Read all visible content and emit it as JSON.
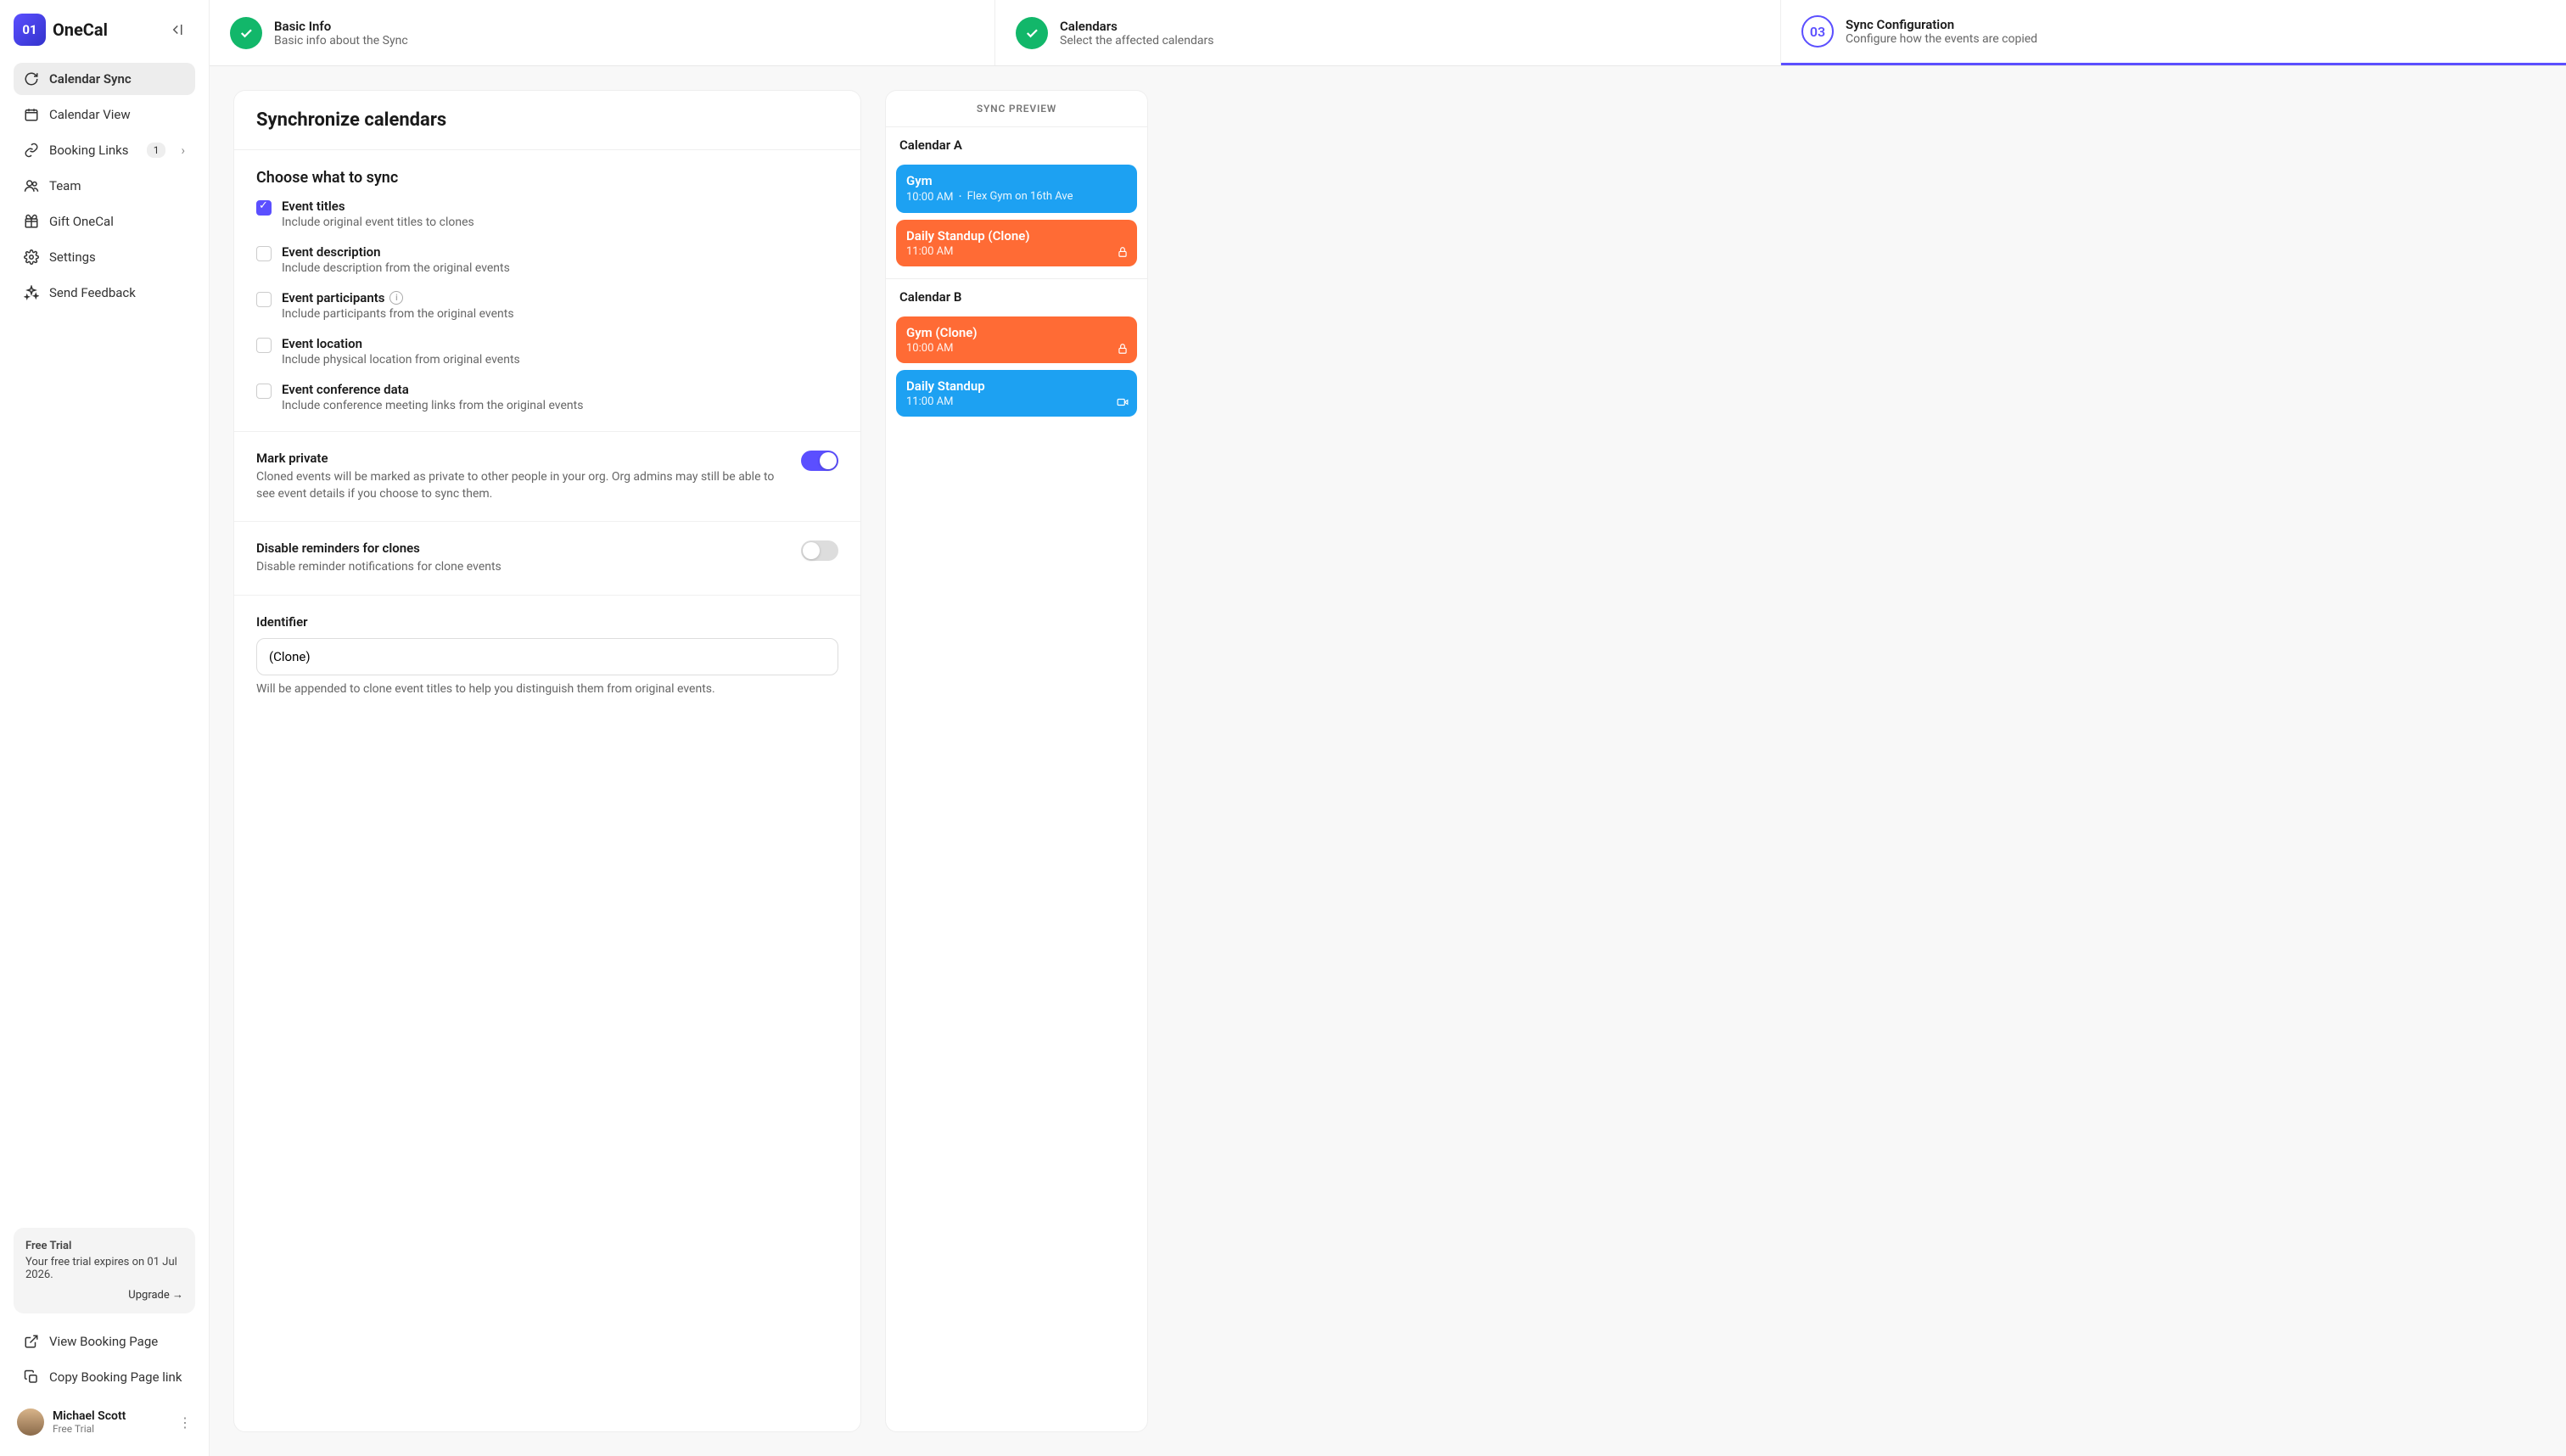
{
  "brand": {
    "logo_text": "OneCal",
    "logo_badge": "01"
  },
  "sidebar": {
    "items": [
      {
        "label": "Calendar Sync",
        "icon": "sync"
      },
      {
        "label": "Calendar View",
        "icon": "calendar"
      },
      {
        "label": "Booking Links",
        "icon": "link",
        "badge": "1",
        "expandable": true
      },
      {
        "label": "Team",
        "icon": "people"
      },
      {
        "label": "Gift OneCal",
        "icon": "gift"
      },
      {
        "label": "Settings",
        "icon": "gear"
      },
      {
        "label": "Send Feedback",
        "icon": "sparkle"
      }
    ],
    "trial": {
      "title": "Free Trial",
      "body": "Your free trial expires on 01 Jul 2026.",
      "upgrade": "Upgrade →"
    },
    "bottom": [
      {
        "label": "View Booking Page",
        "icon": "external"
      },
      {
        "label": "Copy Booking Page link",
        "icon": "copy"
      }
    ],
    "user": {
      "name": "Michael Scott",
      "plan": "Free Trial"
    }
  },
  "stepper": [
    {
      "title": "Basic Info",
      "sub": "Basic info about the Sync",
      "state": "done"
    },
    {
      "title": "Calendars",
      "sub": "Select the affected calendars",
      "state": "done"
    },
    {
      "title": "Sync Configuration",
      "sub": "Configure how the events are copied",
      "state": "active",
      "num": "03"
    }
  ],
  "sync": {
    "heading": "Synchronize calendars",
    "choose_heading": "Choose what to sync",
    "options": [
      {
        "label": "Event titles",
        "desc": "Include original event titles to clones",
        "checked": true
      },
      {
        "label": "Event description",
        "desc": "Include description from the original events",
        "checked": false
      },
      {
        "label": "Event participants",
        "desc": "Include participants from the original events",
        "checked": false,
        "info": true
      },
      {
        "label": "Event location",
        "desc": "Include physical location from original events",
        "checked": false
      },
      {
        "label": "Event conference data",
        "desc": "Include conference meeting links from the original events",
        "checked": false
      }
    ],
    "mark_private": {
      "title": "Mark private",
      "desc": "Cloned events will be marked as private to other people in your org. Org admins may still be able to see event details if you choose to sync them.",
      "on": true
    },
    "reminders": {
      "title": "Disable reminders for clones",
      "desc": "Disable reminder notifications for clone events",
      "on": false
    },
    "identifier": {
      "label": "Identifier",
      "value": "(Clone)",
      "help": "Will be appended to clone event titles to help you distinguish them from original events."
    }
  },
  "preview": {
    "heading": "SYNC PREVIEW",
    "calendars": [
      {
        "name": "Calendar A",
        "events": [
          {
            "name": "Gym",
            "time": "10:00 AM",
            "location": "Flex Gym on 16th Ave",
            "color": "blue"
          },
          {
            "name": "Daily Standup (Clone)",
            "time": "11:00 AM",
            "color": "orange",
            "icon": "lock"
          }
        ]
      },
      {
        "name": "Calendar B",
        "events": [
          {
            "name": "Gym (Clone)",
            "time": "10:00 AM",
            "color": "orange",
            "icon": "lock"
          },
          {
            "name": "Daily Standup",
            "time": "11:00 AM",
            "color": "blue",
            "icon": "video"
          }
        ]
      }
    ]
  }
}
